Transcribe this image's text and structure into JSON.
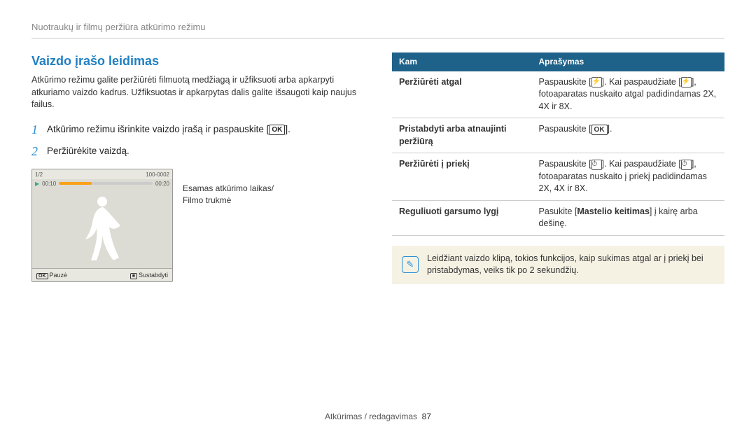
{
  "breadcrumb": "Nuotraukų ir filmų peržiūra atkūrimo režimu",
  "heading": "Vaizdo įrašo leidimas",
  "intro": "Atkūrimo režimu galite peržiūrėti filmuotą medžiagą ir užfiksuoti arba apkarpyti atkuriamo vaizdo kadrus. Užfiksuotas ir apkarpytas dalis galite išsaugoti kaip naujus failus.",
  "steps": [
    {
      "num": "1",
      "text_a": "Atkūrimo režimu išrinkite vaizdo įrašą ir paspauskite [",
      "text_b": "]."
    },
    {
      "num": "2",
      "text_a": "Peržiūrėkite vaizdą.",
      "text_b": ""
    }
  ],
  "ok_label": "OK",
  "screen": {
    "counter": "1/2",
    "battery_info": "100-0002",
    "time_current": "00:10",
    "time_total": "00:20",
    "footer_left": "Pauzė",
    "footer_right": "Sustabdyti"
  },
  "caption_l1": "Esamas atkūrimo laikas/",
  "caption_l2": "Filmo trukmė",
  "table": {
    "head1": "Kam",
    "head2": "Aprašymas",
    "rows": [
      {
        "k": "Peržiūrėti atgal",
        "v_a": "Paspauskite [",
        "v_b": "]. Kai paspaudžiate [",
        "v_c": "], fotoaparatas nuskaito atgal padidindamas 2X, 4X ir 8X.",
        "icon": "flash"
      },
      {
        "k": "Pristabdyti arba atnaujinti peržiūrą",
        "v_a": "Paspauskite [",
        "v_b": "].",
        "v_c": "",
        "icon": "ok"
      },
      {
        "k": "Peržiūrėti į priekį",
        "v_a": "Paspauskite [",
        "v_b": "]. Kai paspaudžiate [",
        "v_c": "], fotoaparatas nuskaito į priekį padidindamas 2X, 4X ir 8X.",
        "icon": "timer"
      },
      {
        "k": "Reguliuoti garsumo lygį",
        "v_plain_a": "Pasukite [",
        "v_bold": "Mastelio keitimas",
        "v_plain_b": "] į kairę arba dešinę."
      }
    ]
  },
  "note": "Leidžiant vaizdo klipą, tokios funkcijos, kaip sukimas atgal ar į priekį bei pristabdymas, veiks tik po 2 sekundžių.",
  "footer_a": "Atkūrimas / redagavimas",
  "footer_page": "87"
}
